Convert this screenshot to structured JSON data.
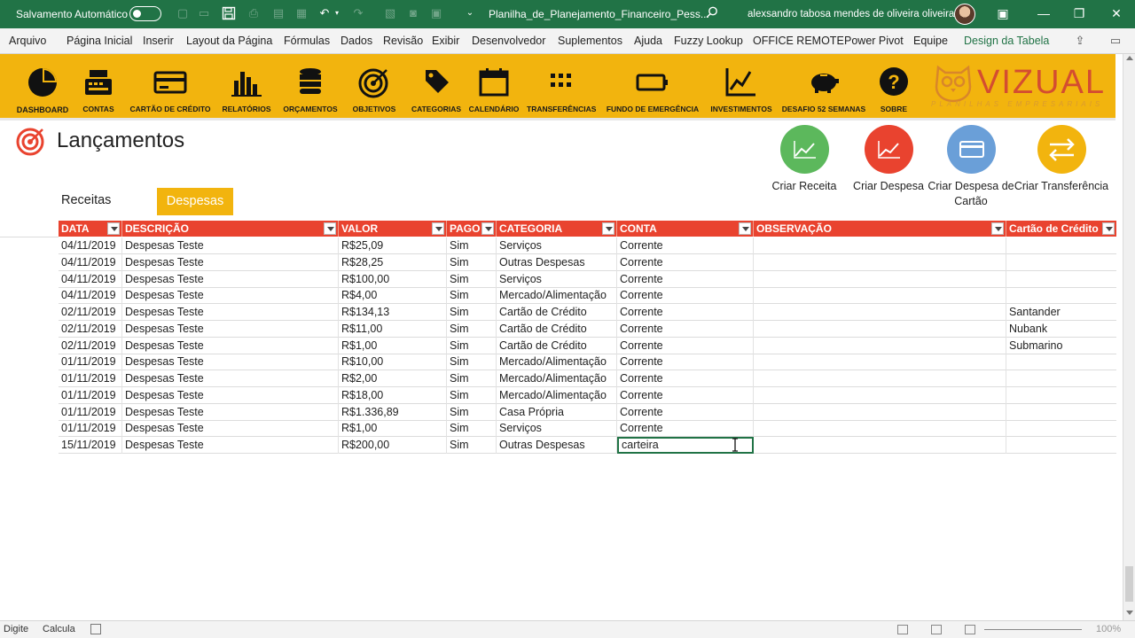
{
  "titlebar": {
    "autosave_label": "Salvamento Automático",
    "filename": "Planilha_de_Planejamento_Financeiro_Pess...",
    "user_name": "alexsandro tabosa mendes de oliveira oliveira"
  },
  "menu": {
    "items": [
      "Arquivo",
      "Página Inicial",
      "Inserir",
      "Layout da Página",
      "Fórmulas",
      "Dados",
      "Revisão",
      "Exibir",
      "Desenvolvedor",
      "Suplementos",
      "Ajuda",
      "Fuzzy Lookup",
      "OFFICE REMOTE",
      "Power Pivot",
      "Equipe",
      "Design da Tabela"
    ]
  },
  "toolbar": {
    "items": [
      "DASHBOARD",
      "CONTAS",
      "CARTÃO DE CRÉDITO",
      "RELATÓRIOS",
      "ORÇAMENTOS",
      "OBJETIVOS",
      "CATEGORIAS",
      "CALENDÁRIO",
      "TRANSFERÊNCIAS",
      "FUNDO DE EMERGÊNCIA",
      "INVESTIMENTOS",
      "DESAFIO 52 SEMANAS",
      "SOBRE"
    ],
    "brand_name": "VIZUAL",
    "brand_sub": "PLANILHAS EMPRESARIAIS"
  },
  "page": {
    "title": "Lançamentos",
    "tab_receitas": "Receitas",
    "tab_despesas": "Despesas"
  },
  "actions": [
    {
      "label": "Criar Receita",
      "color": "#5cb85c"
    },
    {
      "label": "Criar Despesa",
      "color": "#e9432f"
    },
    {
      "label": "Criar Despesa de Cartão",
      "color": "#6a9fd8"
    },
    {
      "label": "Criar Transferência",
      "color": "#f2b40e"
    }
  ],
  "table": {
    "headers": [
      "DATA",
      "DESCRIÇÃO",
      "VALOR",
      "PAGO",
      "CATEGORIA",
      "CONTA",
      "OBSERVAÇÃO",
      "Cartão de Crédito"
    ],
    "rows": [
      [
        "04/11/2019",
        "Despesas Teste",
        "R$25,09",
        "Sim",
        "Serviços",
        "Corrente",
        "",
        ""
      ],
      [
        "04/11/2019",
        "Despesas Teste",
        "R$28,25",
        "Sim",
        "Outras Despesas",
        "Corrente",
        "",
        ""
      ],
      [
        "04/11/2019",
        "Despesas Teste",
        "R$100,00",
        "Sim",
        "Serviços",
        "Corrente",
        "",
        ""
      ],
      [
        "04/11/2019",
        "Despesas Teste",
        "R$4,00",
        "Sim",
        "Mercado/Alimentação",
        "Corrente",
        "",
        ""
      ],
      [
        "02/11/2019",
        "Despesas Teste",
        "R$134,13",
        "Sim",
        "Cartão de Crédito",
        "Corrente",
        "",
        "Santander"
      ],
      [
        "02/11/2019",
        "Despesas Teste",
        "R$11,00",
        "Sim",
        "Cartão de Crédito",
        "Corrente",
        "",
        "Nubank"
      ],
      [
        "02/11/2019",
        "Despesas Teste",
        "R$1,00",
        "Sim",
        "Cartão de Crédito",
        "Corrente",
        "",
        "Submarino"
      ],
      [
        "01/11/2019",
        "Despesas Teste",
        "R$10,00",
        "Sim",
        "Mercado/Alimentação",
        "Corrente",
        "",
        ""
      ],
      [
        "01/11/2019",
        "Despesas Teste",
        "R$2,00",
        "Sim",
        "Mercado/Alimentação",
        "Corrente",
        "",
        ""
      ],
      [
        "01/11/2019",
        "Despesas Teste",
        "R$18,00",
        "Sim",
        "Mercado/Alimentação",
        "Corrente",
        "",
        ""
      ],
      [
        "01/11/2019",
        "Despesas Teste",
        "R$1.336,89",
        "Sim",
        "Casa Própria",
        "Corrente",
        "",
        ""
      ],
      [
        "01/11/2019",
        "Despesas Teste",
        "R$1,00",
        "Sim",
        "Serviços",
        "Corrente",
        "",
        ""
      ],
      [
        "15/11/2019",
        "Despesas Teste",
        "R$200,00",
        "Sim",
        "Outras Despesas",
        "carteira",
        "",
        ""
      ]
    ]
  },
  "status": {
    "mode": "Digite",
    "calc": "Calcula",
    "zoom": "100%"
  },
  "colors": {
    "excel_green": "#217346",
    "toolbar_yellow": "#f2b40e",
    "header_red": "#e9432f"
  }
}
